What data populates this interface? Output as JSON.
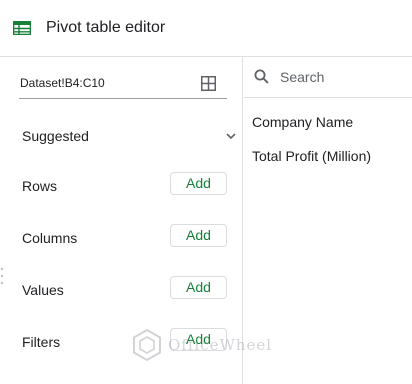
{
  "header": {
    "title": "Pivot table editor",
    "icon": "sheets-table-icon"
  },
  "data_range": {
    "value": "Dataset!B4:C10",
    "icon": "grid-select-icon"
  },
  "suggested": {
    "label": "Suggested"
  },
  "sections": [
    {
      "label": "Rows",
      "button": "Add"
    },
    {
      "label": "Columns",
      "button": "Add"
    },
    {
      "label": "Values",
      "button": "Add"
    },
    {
      "label": "Filters",
      "button": "Add"
    }
  ],
  "search": {
    "placeholder": "Search",
    "value": ""
  },
  "fields": [
    "Company Name",
    "Total Profit (Million)"
  ],
  "watermark": {
    "text": "OfficeWheel"
  },
  "colors": {
    "accent": "#188038",
    "border": "#dadce0",
    "text": "#202124"
  }
}
